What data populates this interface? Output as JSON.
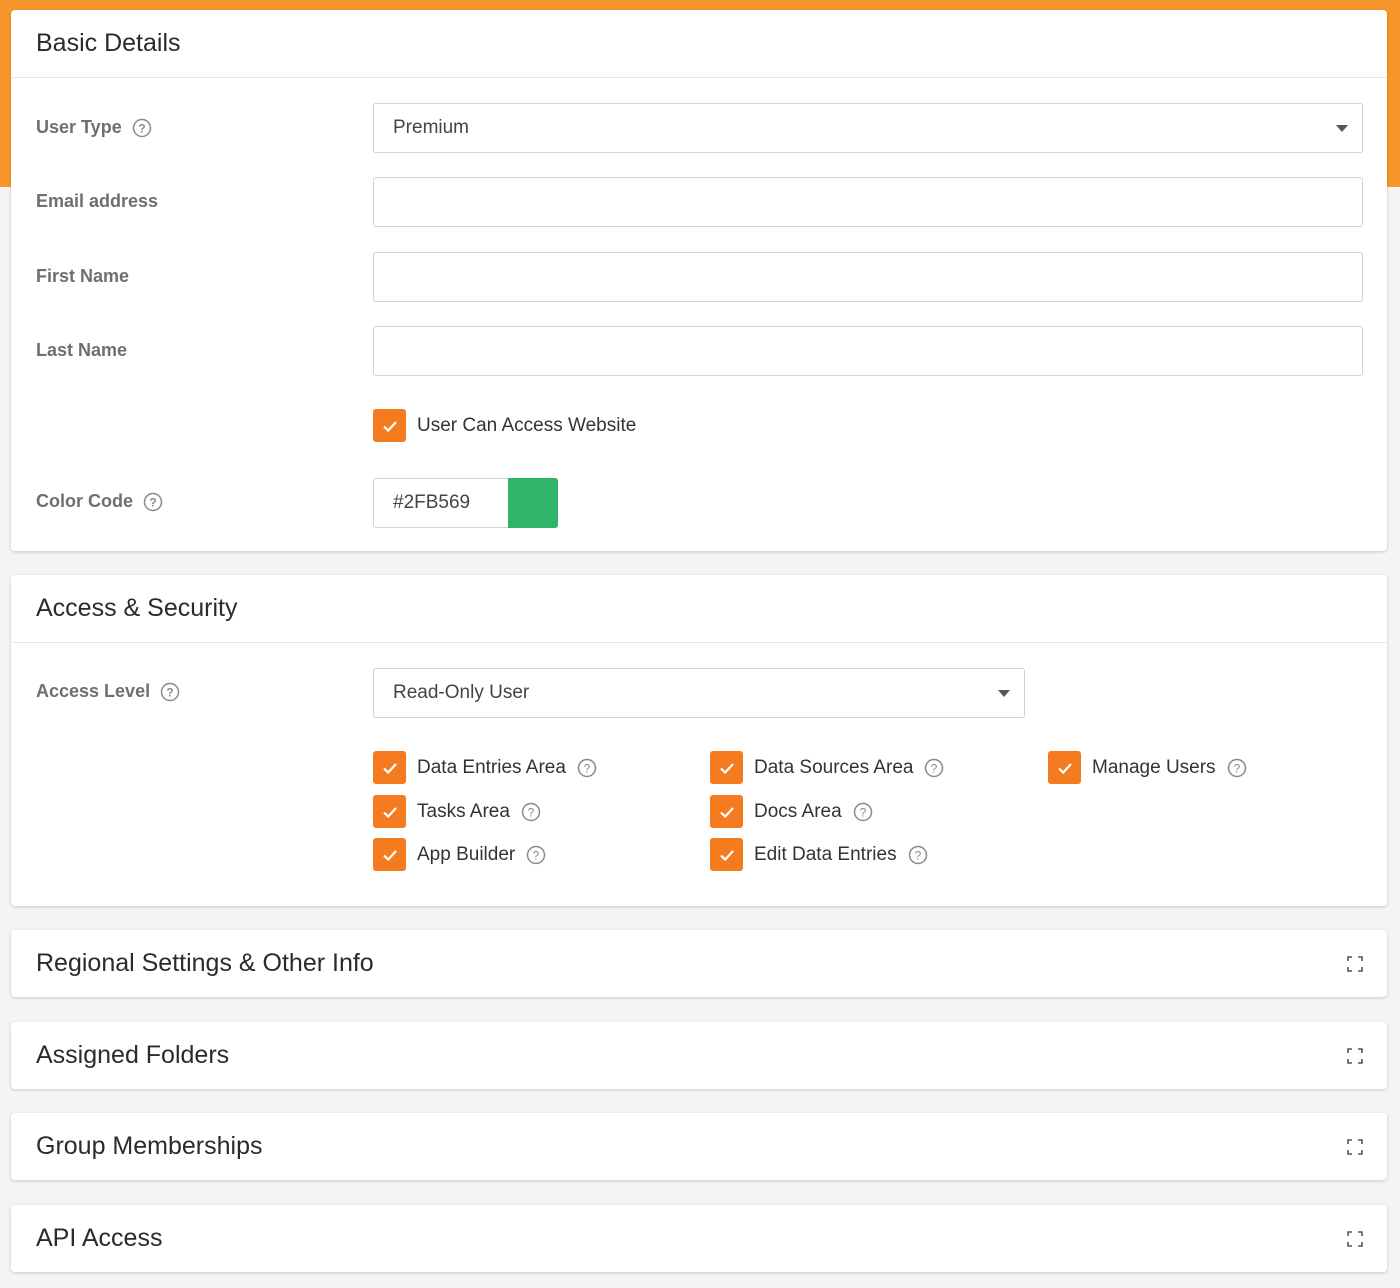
{
  "colors": {
    "accent": "#f7962b",
    "check": "#f47b20",
    "swatch": "#2FB569"
  },
  "basic": {
    "title": "Basic Details",
    "user_type_label": "User Type",
    "user_type_value": "Premium",
    "email_label": "Email address",
    "email_value": "",
    "first_name_label": "First Name",
    "first_name_value": "",
    "last_name_label": "Last Name",
    "last_name_value": "",
    "website_access_label": "User Can Access Website",
    "color_code_label": "Color Code",
    "color_code_value": "#2FB569"
  },
  "access": {
    "title": "Access & Security",
    "access_level_label": "Access Level",
    "access_level_value": "Read-Only User",
    "permissions": [
      {
        "label": "Data Entries Area",
        "checked": true
      },
      {
        "label": "Tasks Area",
        "checked": true
      },
      {
        "label": "App Builder",
        "checked": true
      },
      {
        "label": "Data Sources Area",
        "checked": true
      },
      {
        "label": "Docs Area",
        "checked": true
      },
      {
        "label": "Edit Data Entries",
        "checked": true
      },
      {
        "label": "Manage Users",
        "checked": true
      }
    ]
  },
  "collapsed_sections": [
    {
      "title": "Regional Settings & Other Info"
    },
    {
      "title": "Assigned Folders"
    },
    {
      "title": "Group Memberships"
    },
    {
      "title": "API Access"
    }
  ]
}
